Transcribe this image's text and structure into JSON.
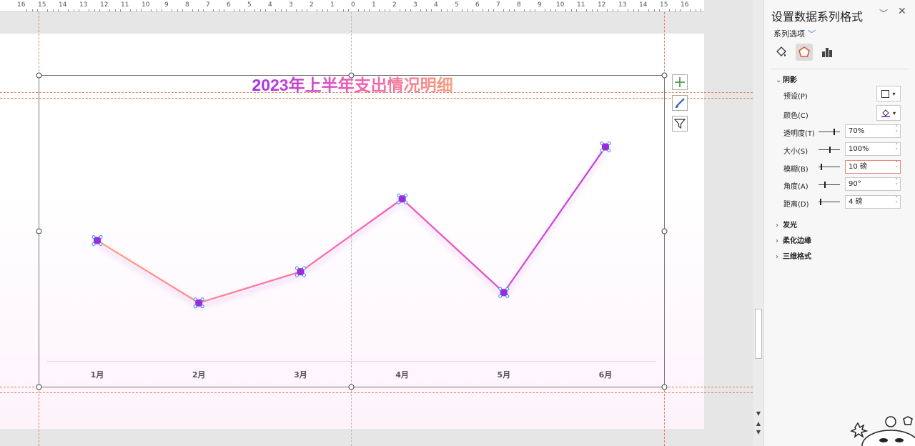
{
  "ruler": {
    "labels": [
      "16",
      "15",
      "14",
      "13",
      "12",
      "11",
      "10",
      "9",
      "8",
      "7",
      "6",
      "5",
      "4",
      "3",
      "2",
      "1",
      "0",
      "1",
      "2",
      "3",
      "4",
      "5",
      "6",
      "7",
      "8",
      "9",
      "10",
      "11",
      "12",
      "13",
      "14",
      "15",
      "16"
    ]
  },
  "chart_tools": {
    "add_element_icon": "plus-icon",
    "style_icon": "brush-icon",
    "filter_icon": "funnel-icon"
  },
  "chart_data": {
    "type": "line",
    "title": "2023年上半年支出情况明细",
    "categories": [
      "1月",
      "2月",
      "3月",
      "4月",
      "5月",
      "6月"
    ],
    "values": [
      60,
      36,
      48,
      76,
      40,
      96
    ],
    "ylim": [
      20,
      100
    ],
    "grid": false,
    "legend": "none",
    "colors": {
      "line_start": "#ffa07a",
      "line_mid": "#f55fb8",
      "line_end": "#b544d8",
      "marker": "#9d2bd9",
      "marker_outline": "#3a86ff",
      "title_start": "#a333e0",
      "title_mid": "#f05bb5",
      "title_end": "#f6a07c"
    }
  },
  "pane": {
    "title": "设置数据系列格式",
    "series_options": "系列选项",
    "tabs": [
      "fill-line-icon",
      "effects-icon",
      "series-options-icon"
    ],
    "sections": {
      "shadow": "阴影",
      "glow": "发光",
      "soft_edges": "柔化边缘",
      "three_d": "三维格式"
    },
    "fields": {
      "preset": "预设(P)",
      "color": "颜色(C)",
      "transparency": {
        "label": "透明度(T)",
        "value": "70%",
        "level": 0.7
      },
      "size": {
        "label": "大小(S)",
        "value": "100%",
        "level": 0.5
      },
      "blur": {
        "label": "模糊(B)",
        "value": "10 磅",
        "level": 0.1
      },
      "angle": {
        "label": "角度(A)",
        "value": "90°",
        "level": 0.25
      },
      "distance": {
        "label": "距离(D)",
        "value": "4 磅",
        "level": 0.05
      }
    }
  }
}
